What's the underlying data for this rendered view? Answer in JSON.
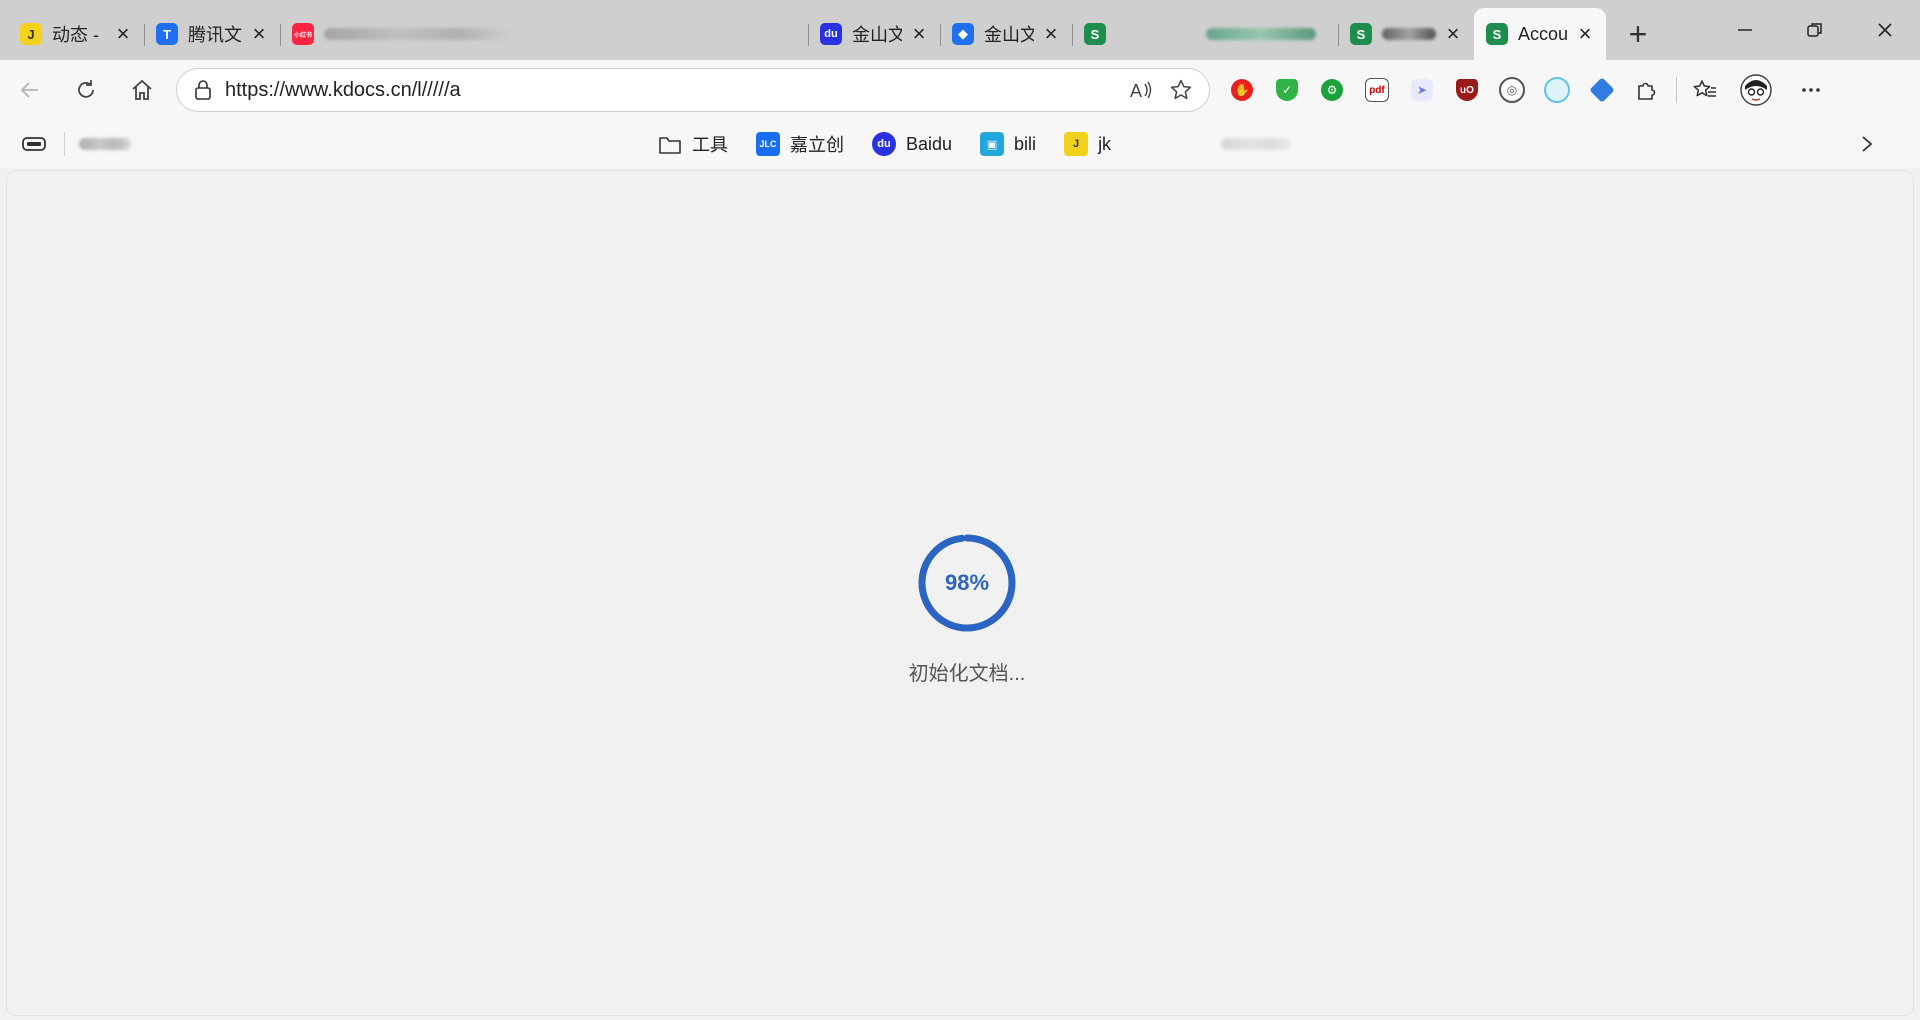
{
  "tabs": [
    {
      "title": "动态 -",
      "favicon_text": "J",
      "favicon_color": "#f4d21c",
      "favicon_fg": "#333"
    },
    {
      "title": "腾讯文",
      "favicon_text": "T",
      "favicon_color": "#1f6ff2",
      "favicon_fg": "#fff"
    },
    {
      "title": "",
      "favicon_text": "小红书",
      "favicon_color": "#ff2442",
      "favicon_fg": "#fff",
      "blurred": true
    },
    {
      "title": "金山文",
      "favicon_text": "du",
      "favicon_color": "#2932e1",
      "favicon_fg": "#fff"
    },
    {
      "title": "金山文",
      "favicon_text": "◆",
      "favicon_color": "#1f6ff2",
      "favicon_fg": "#fff"
    },
    {
      "title": "",
      "favicon_text": "S",
      "favicon_color": "#1e8e4e",
      "favicon_fg": "#fff",
      "blurred": true
    },
    {
      "title": "",
      "favicon_text": "S",
      "favicon_color": "#1e8e4e",
      "favicon_fg": "#fff",
      "blurred": true
    },
    {
      "title": "Accou",
      "favicon_text": "S",
      "favicon_color": "#1e8e4e",
      "favicon_fg": "#fff",
      "active": true
    }
  ],
  "address_bar": {
    "url": "https://www.kdocs.cn/l/////a"
  },
  "extensions": [
    {
      "name": "adblock-icon",
      "color": "#e8211f",
      "glyph": "✋"
    },
    {
      "name": "shield-check-icon",
      "color": "#2fb344",
      "glyph": "✓"
    },
    {
      "name": "tampermonkey-icon",
      "color": "#1aa33c",
      "glyph": "⚙"
    },
    {
      "name": "pdf-icon",
      "color": "#ffffff",
      "glyph": "pdf"
    },
    {
      "name": "paper-plane-icon",
      "color": "#6a7df0",
      "glyph": "➤"
    },
    {
      "name": "ublock-icon",
      "color": "#9a1a1a",
      "glyph": "uO"
    },
    {
      "name": "translate-icon",
      "color": "#555555",
      "glyph": "◎"
    },
    {
      "name": "cloud-icon",
      "color": "#64c3e8",
      "glyph": "○"
    },
    {
      "name": "cube-icon",
      "color": "#2d7de2",
      "glyph": "◆"
    }
  ],
  "bookmarks": [
    {
      "label": "工具",
      "icon": "folder-icon",
      "color": "#ffffff",
      "glyph": ""
    },
    {
      "label": "嘉立创",
      "icon": "jlc-icon",
      "color": "#1b6ef3",
      "glyph": "JLC"
    },
    {
      "label": "Baidu",
      "icon": "baidu-icon",
      "color": "#2932e1",
      "glyph": "du"
    },
    {
      "label": "bili",
      "icon": "bilibili-icon",
      "color": "#22a7e0",
      "glyph": "▣"
    },
    {
      "label": "jk",
      "icon": "jk-icon",
      "color": "#f4d21c",
      "glyph": "J"
    }
  ],
  "loader": {
    "percent_label": "98%",
    "progress": 0.98,
    "status_text": "初始化文档...",
    "ring_color": "#2c64c4"
  }
}
